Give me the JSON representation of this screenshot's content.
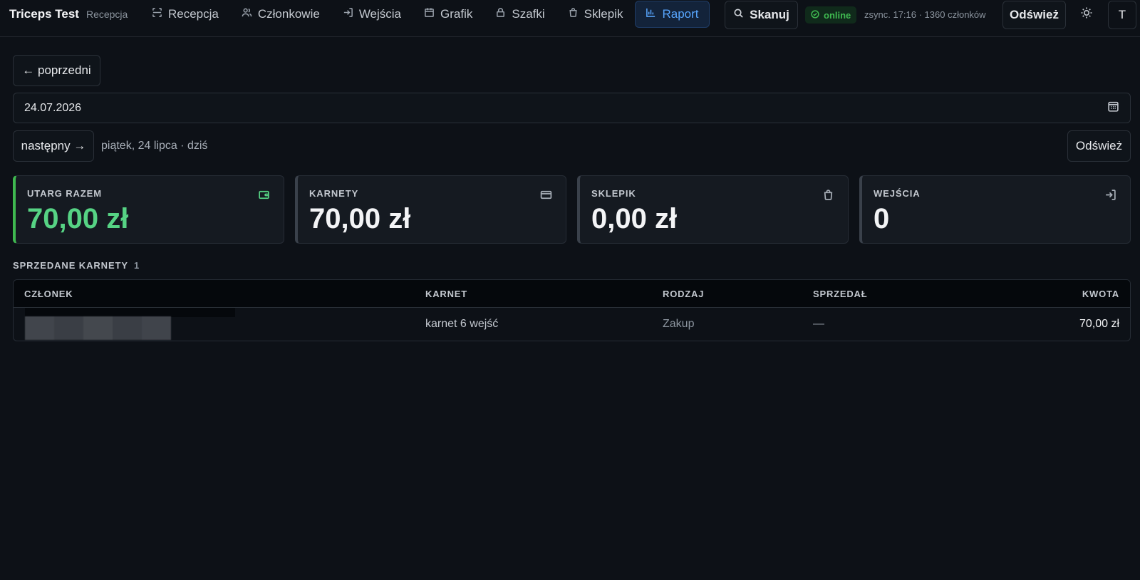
{
  "app": {
    "title": "Triceps Test",
    "subtitle": "Recepcja"
  },
  "nav": {
    "items": [
      {
        "label": "Recepcja",
        "icon": "scan-frame-icon"
      },
      {
        "label": "Członkowie",
        "icon": "users-icon"
      },
      {
        "label": "Wejścia",
        "icon": "login-icon"
      },
      {
        "label": "Grafik",
        "icon": "calendar-icon"
      },
      {
        "label": "Szafki",
        "icon": "lock-icon"
      },
      {
        "label": "Sklepik",
        "icon": "shopping-bag-icon"
      },
      {
        "label": "Raport",
        "icon": "bar-chart-icon",
        "active": true
      }
    ]
  },
  "toolbar": {
    "scan_label": "Skanuj",
    "online_label": "online",
    "sync_text": "zsync. 17:16 · 1360 członków",
    "refresh_label": "Odśwież",
    "avatar_initial": "T"
  },
  "date_controls": {
    "prev_label": "← poprzedni",
    "date_value": "24.07.2026",
    "next_label": "następny →",
    "date_description": "piątek, 24 lipca · dziś",
    "refresh_label": "Odśwież"
  },
  "stats": [
    {
      "label": "UTARG RAZEM",
      "value": "70,00 zł",
      "icon": "wallet-icon",
      "accent": true
    },
    {
      "label": "KARNETY",
      "value": "70,00 zł",
      "icon": "credit-card-icon"
    },
    {
      "label": "SKLEPIK",
      "value": "0,00 zł",
      "icon": "shopping-bag-icon"
    },
    {
      "label": "WEJŚCIA",
      "value": "0",
      "icon": "login-icon"
    }
  ],
  "sold_passes": {
    "title": "SPRZEDANE KARNETY",
    "count": "1",
    "columns": [
      "CZŁONEK",
      "KARNET",
      "RODZAJ",
      "SPRZEDAŁ",
      "KWOTA"
    ],
    "rows": [
      {
        "member": "",
        "pass": "karnet 6 wejść",
        "type": "Zakup",
        "seller": "—",
        "amount": "70,00 zł"
      }
    ]
  },
  "colors": {
    "background": "#0d1117",
    "accent_blue": "#58a6ff",
    "accent_green": "#56d384",
    "online_green": "#3fb950"
  }
}
